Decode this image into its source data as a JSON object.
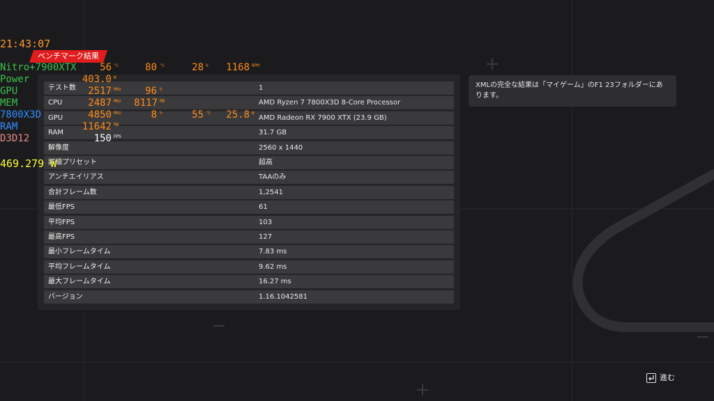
{
  "overlay": {
    "clock": "21:43:07",
    "watt": "469.279 W",
    "gpu_model_label": "Nitro+7900XTX",
    "power_label": "Power",
    "gpu_label": "GPU",
    "mem_label": "MEM",
    "cpu_label": "7800X3D",
    "ram_label": "RAM",
    "api_label": "D3D12",
    "gpu_temp": "56",
    "gpu_temp_unit": "°C",
    "hotspot": "80",
    "hotspot_unit": "°C",
    "fan": "28",
    "fan_unit": "%",
    "rpm": "1168",
    "rpm_unit": "RPM",
    "power": "403.0",
    "power_unit": "W",
    "gpu_clock": "2517",
    "gpu_clock_unit": "MHz",
    "gpu_load": "96",
    "gpu_load_unit": "%",
    "mem_clock": "2487",
    "mem_clock_unit": "MHz",
    "mem_used": "8117",
    "mem_used_unit": "MB",
    "cpu_clock": "4850",
    "cpu_clock_unit": "MHz",
    "cpu_load": "8",
    "cpu_load_unit": "%",
    "cpu_temp": "55",
    "cpu_temp_unit": "°C",
    "cpu_power": "25.8",
    "cpu_power_unit": "W",
    "ram_used": "11642",
    "ram_used_unit": "MB",
    "fps": "150",
    "fps_unit": "FPS"
  },
  "header": {
    "tag": "ベンチマーク結果"
  },
  "results": [
    {
      "key": "テスト数",
      "value": "1"
    },
    {
      "key": "CPU",
      "value": "AMD Ryzen 7 7800X3D 8-Core Processor"
    },
    {
      "key": "GPU",
      "value": "AMD Radeon RX 7900 XTX (23.9 GB)"
    },
    {
      "key": "RAM",
      "value": "31.7 GB"
    },
    {
      "key": "解像度",
      "value": "2560 x 1440"
    },
    {
      "key": "詳細プリセット",
      "value": "超高"
    },
    {
      "key": "アンチエイリアス",
      "value": "TAAのみ"
    },
    {
      "key": "合計フレーム数",
      "value": "1,2541"
    },
    {
      "key": "最低FPS",
      "value": "61"
    },
    {
      "key": "平均FPS",
      "value": "103"
    },
    {
      "key": "最高FPS",
      "value": "127"
    },
    {
      "key": "最小フレームタイム",
      "value": "7.83 ms"
    },
    {
      "key": "平均フレームタイム",
      "value": "9.62 ms"
    },
    {
      "key": "最大フレームタイム",
      "value": "16.27 ms"
    },
    {
      "key": "バージョン",
      "value": "1.16.1042581"
    }
  ],
  "info": {
    "text": "XMLの完全な結果は「マイゲーム」のF1 23フォルダーにあります。"
  },
  "footer": {
    "next_label": "進む"
  }
}
